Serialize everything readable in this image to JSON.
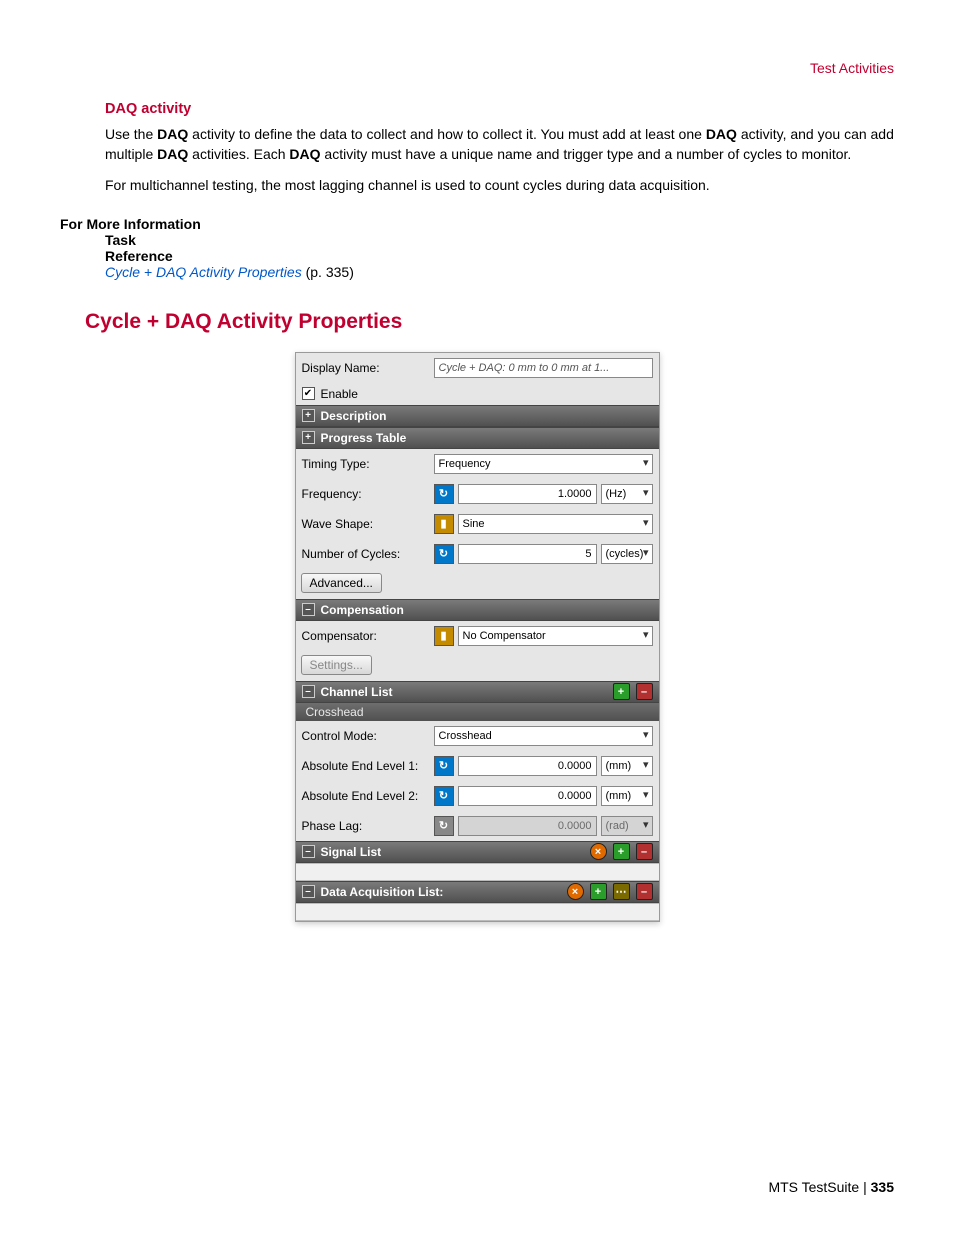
{
  "header_link": "Test Activities",
  "intro": {
    "title": "DAQ activity",
    "para1_a": "Use the ",
    "para1_b": "DAQ",
    "para1_c": " activity to define the data to collect and how to collect it. You must add at least one ",
    "para1_d": "DAQ",
    "para1_e": " activity, and you can add multiple ",
    "para1_f": "DAQ",
    "para1_g": " activities. Each ",
    "para1_h": "DAQ",
    "para1_i": " activity must have a unique name and trigger type and a number of cycles to monitor.",
    "para2": "For multichannel testing, the most lagging channel is used to count cycles during data acquisition."
  },
  "moreinfo": {
    "heading": "For More Information",
    "task": "Task",
    "reference": "Reference",
    "link_text": "Cycle + DAQ Activity Properties",
    "page_ref": "  (p. 335)"
  },
  "heading_main": "Cycle + DAQ Activity Properties",
  "panel": {
    "display_name_label": "Display Name:",
    "display_name_value": "Cycle + DAQ: 0 mm to 0 mm at 1...",
    "enable_label": "Enable",
    "bar_description": "Description",
    "bar_progress": "Progress Table",
    "timing_type_label": "Timing Type:",
    "timing_type_value": "Frequency",
    "frequency_label": "Frequency:",
    "frequency_value": "1.0000",
    "frequency_unit": "(Hz)",
    "wave_shape_label": "Wave Shape:",
    "wave_shape_value": "Sine",
    "cycles_label": "Number of Cycles:",
    "cycles_value": "5",
    "cycles_unit": "(cycles)",
    "advanced_btn": "Advanced...",
    "bar_compensation": "Compensation",
    "compensator_label": "Compensator:",
    "compensator_value": "No Compensator",
    "settings_btn": "Settings...",
    "bar_channel_list": "Channel List",
    "channel_item": "Crosshead",
    "control_mode_label": "Control Mode:",
    "control_mode_value": "Crosshead",
    "abs1_label": "Absolute End Level 1:",
    "abs1_value": "0.0000",
    "abs1_unit": "(mm)",
    "abs2_label": "Absolute End Level 2:",
    "abs2_value": "0.0000",
    "abs2_unit": "(mm)",
    "phase_label": "Phase Lag:",
    "phase_value": "0.0000",
    "phase_unit": "(rad)",
    "bar_signal_list": "Signal List",
    "bar_daq_list": "Data Acquisition List:"
  },
  "footer": {
    "product": "MTS TestSuite | ",
    "page": "335"
  }
}
